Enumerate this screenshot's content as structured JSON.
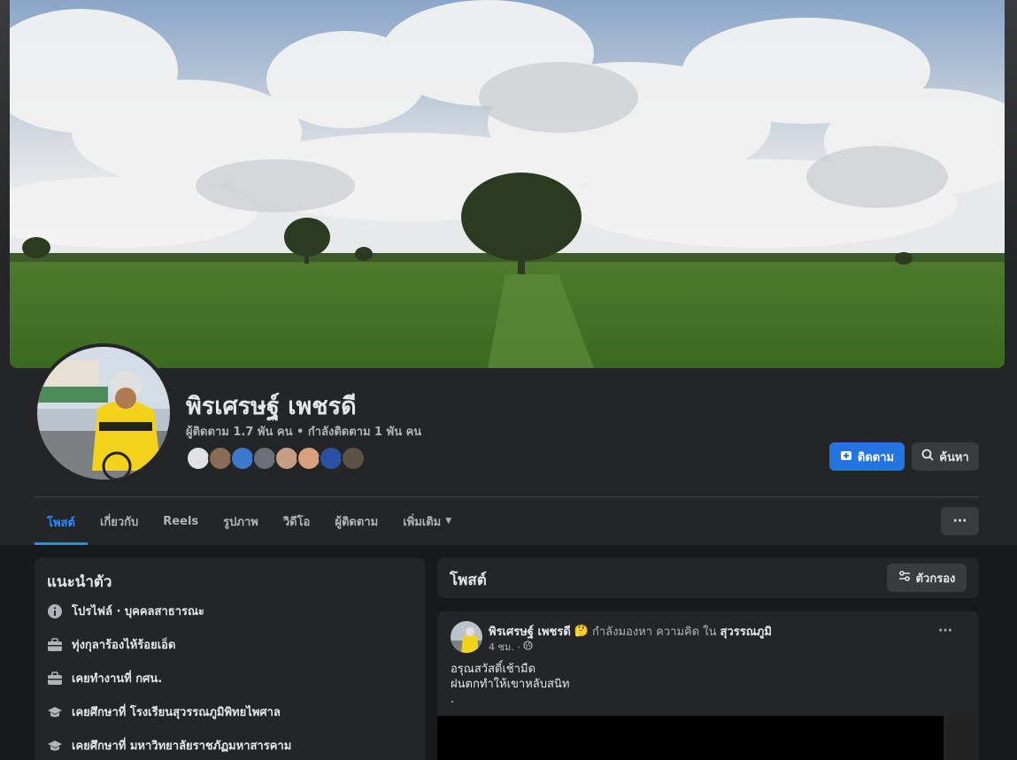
{
  "profile": {
    "name": "พิรเศรษฐ์ เพชรดี",
    "followers_text": "ผู้ติดตาม 1.7 พัน คน",
    "separator": "•",
    "following_text": "กำลังติดตาม 1 พัน คน"
  },
  "actions": {
    "follow_label": "ติดตาม",
    "search_label": "ค้นหา"
  },
  "tabs": [
    {
      "label": "โพสต์",
      "active": true
    },
    {
      "label": "เกี่ยวกับ"
    },
    {
      "label": "Reels"
    },
    {
      "label": "รูปภาพ"
    },
    {
      "label": "วิดีโอ"
    },
    {
      "label": "ผู้ติดตาม"
    },
    {
      "label": "เพิ่มเติม"
    }
  ],
  "more_button": "···",
  "intro": {
    "title": "แนะนำตัว",
    "items": [
      {
        "icon": "info-icon",
        "text": "โปรไฟล์ · บุคคลสาธารณะ"
      },
      {
        "icon": "briefcase-icon",
        "text": "ทุ่งกุลาร้องไห้ร้อยเอ็ด"
      },
      {
        "icon": "briefcase-icon",
        "text": "เคยทำงานที่ กศน."
      },
      {
        "icon": "graduation-cap-icon",
        "text": "เคยศึกษาที่ โรงเรียนสุวรรณภูมิพิทยไพศาล"
      },
      {
        "icon": "graduation-cap-icon",
        "text": "เคยศึกษาที่ มหาวิทยาลัยราชภัฏมหาสารคาม"
      }
    ]
  },
  "posts": {
    "title": "โพสต์",
    "filter_label": "ตัวกรอง"
  },
  "post": {
    "author": "พิรเศรษฐ์ เพชรดี",
    "emoji": "🤔",
    "feeling": "กำลังมองหา ความคิด ใน",
    "location": "สุวรรณภูมิ",
    "time": "4 ชม. ·",
    "menu": "···",
    "lines": [
      "อรุณสวัสดิ์เช้ามืด",
      "ฝนตกทำให้เขาหลับสนิท",
      "."
    ]
  },
  "colors": {
    "accent": "#2374e1",
    "active_tab": "#2d88ff",
    "background": "#18191a",
    "card": "#242526"
  }
}
